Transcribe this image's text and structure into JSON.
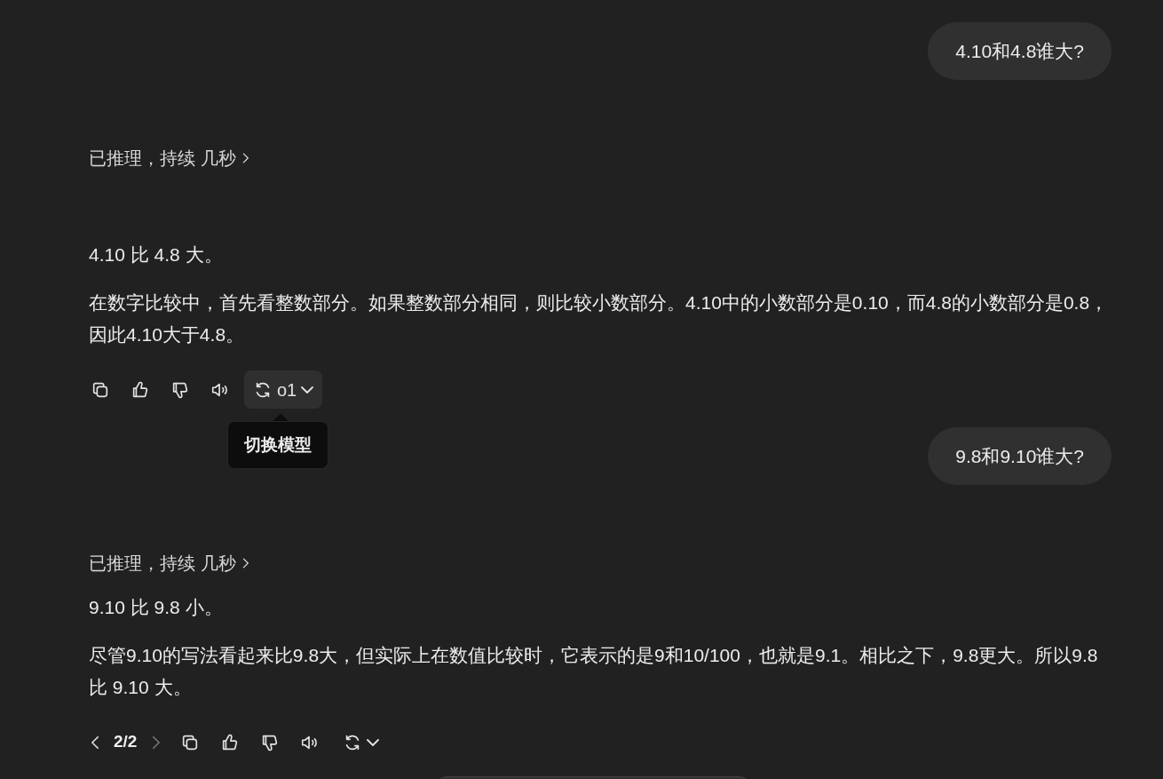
{
  "messages": [
    {
      "kind": "user",
      "text": "4.10和4.8谁大?"
    },
    {
      "kind": "assistant",
      "reasoning": "已推理，持续 几秒",
      "paragraphs": [
        "4.10 比 4.8 大。",
        "在数字比较中，首先看整数部分。如果整数部分相同，则比较小数部分。4.10中的小数部分是0.10，而4.8的小数部分是0.8，因此4.10大于4.8。"
      ],
      "model_button": {
        "label": "o1",
        "hovered": true,
        "tooltip": "切换模型"
      }
    },
    {
      "kind": "user",
      "text": "9.8和9.10谁大?"
    },
    {
      "kind": "assistant",
      "reasoning": "已推理，持续 几秒",
      "paragraphs": [
        "9.10 比 9.8 小。",
        "尽管9.10的写法看起来比9.8大，但实际上在数值比较时，它表示的是9和10/100，也就是9.1。相比之下，9.8更大。所以9.8 比 9.10 大。"
      ],
      "pager": {
        "text": "2/2",
        "prev_disabled": false,
        "next_disabled": true
      },
      "model_button": {
        "hovered": false
      }
    }
  ],
  "composer": {
    "visible": true
  }
}
